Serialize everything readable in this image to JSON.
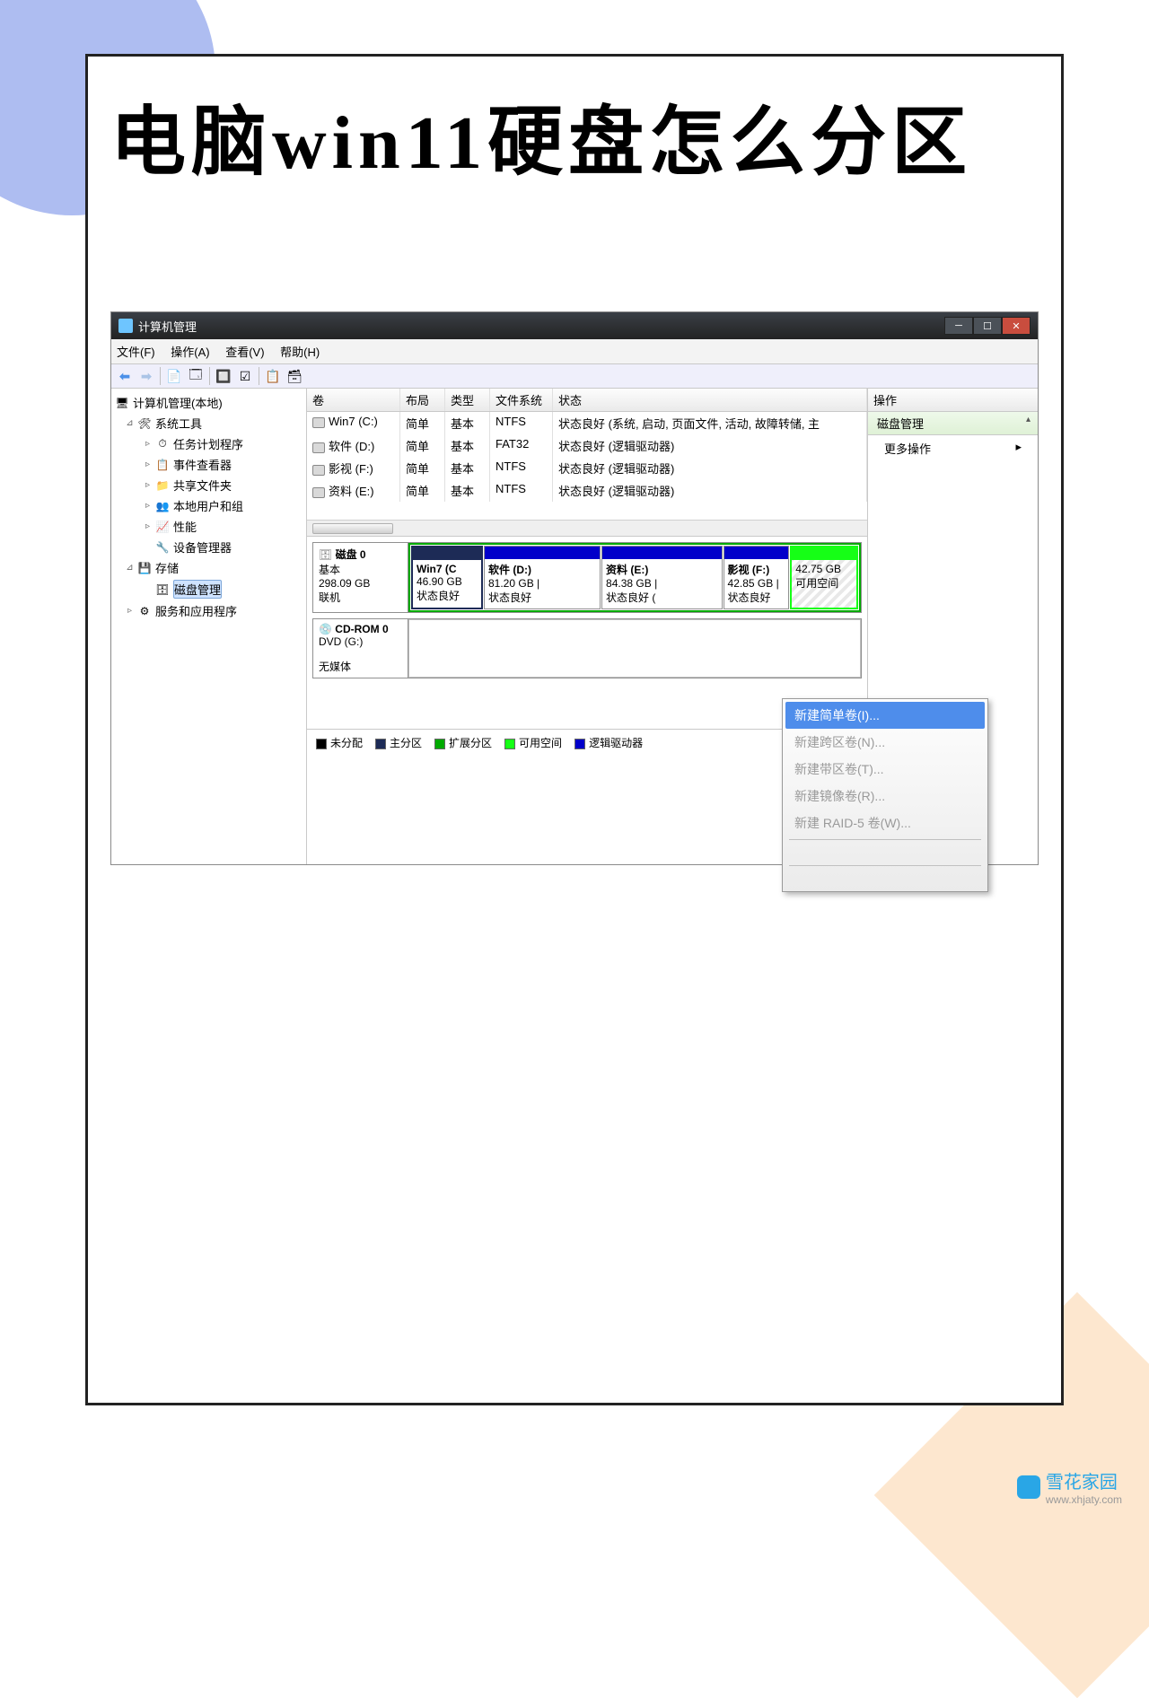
{
  "page": {
    "title": "电脑win11硬盘怎么分区"
  },
  "window": {
    "title": "计算机管理"
  },
  "menu": {
    "file": "文件(F)",
    "action": "操作(A)",
    "view": "查看(V)",
    "help": "帮助(H)"
  },
  "tree": {
    "root": "计算机管理(本地)",
    "sys_tools": "系统工具",
    "task": "任务计划程序",
    "event": "事件查看器",
    "shared": "共享文件夹",
    "users": "本地用户和组",
    "perf": "性能",
    "devmgr": "设备管理器",
    "storage": "存储",
    "diskmgmt": "磁盘管理",
    "svc": "服务和应用程序"
  },
  "volumes": {
    "header": {
      "vol": "卷",
      "layout": "布局",
      "type": "类型",
      "fs": "文件系统",
      "status": "状态"
    },
    "rows": [
      {
        "vol": "Win7 (C:)",
        "layout": "简单",
        "type": "基本",
        "fs": "NTFS",
        "status": "状态良好 (系统, 启动, 页面文件, 活动, 故障转储, 主"
      },
      {
        "vol": "软件 (D:)",
        "layout": "简单",
        "type": "基本",
        "fs": "FAT32",
        "status": "状态良好 (逻辑驱动器)"
      },
      {
        "vol": "影视 (F:)",
        "layout": "简单",
        "type": "基本",
        "fs": "NTFS",
        "status": "状态良好 (逻辑驱动器)"
      },
      {
        "vol": "资料 (E:)",
        "layout": "简单",
        "type": "基本",
        "fs": "NTFS",
        "status": "状态良好 (逻辑驱动器)"
      }
    ]
  },
  "disk0": {
    "name": "磁盘 0",
    "kind": "基本",
    "size": "298.09 GB",
    "state": "联机",
    "parts": [
      {
        "label": "Win7 (C",
        "size": "46.90 GB",
        "stat": "状态良好",
        "color": "sys"
      },
      {
        "label": "软件 (D:)",
        "size": "81.20 GB |",
        "stat": "状态良好",
        "color": "blue"
      },
      {
        "label": "资料 (E:)",
        "size": "84.38 GB |",
        "stat": "状态良好 (",
        "color": "blue"
      },
      {
        "label": "影视 (F:)",
        "size": "42.85 GB |",
        "stat": "状态良好",
        "color": "blue"
      },
      {
        "label": "",
        "size": "42.75 GB",
        "stat": "可用空间",
        "color": "green",
        "hatch": true
      }
    ]
  },
  "cdrom": {
    "name": "CD-ROM 0",
    "kind": "DVD (G:)",
    "state": "无媒体"
  },
  "legend": {
    "unalloc": "未分配",
    "primary": "主分区",
    "ext": "扩展分区",
    "free": "可用空间",
    "logical": "逻辑驱动器"
  },
  "actions": {
    "header": "操作",
    "section": "磁盘管理",
    "more": "更多操作"
  },
  "ctx": {
    "newsimple": "新建简单卷(I)...",
    "newspan": "新建跨区卷(N)...",
    "newstripe": "新建带区卷(T)...",
    "newmirror": "新建镜像卷(R)...",
    "newraid": "新建 RAID-5 卷(W)..."
  },
  "watermark": {
    "brand": "雪花家园",
    "url": "www.xhjaty.com"
  }
}
